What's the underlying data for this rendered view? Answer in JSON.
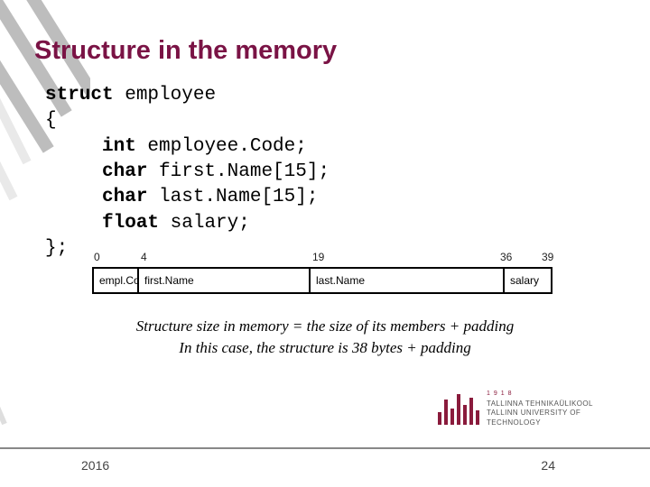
{
  "title": "Structure in the memory",
  "code": {
    "l1a": "struct",
    "l1b": " employee",
    "l2": "{",
    "l3a": "     int",
    "l3b": " employee.Code;",
    "l4a": "     char",
    "l4b": " first.Name[15];",
    "l5a": "     char",
    "l5b": " last.Name[15];",
    "l6a": "     float",
    "l6b": " salary;",
    "l7": "};"
  },
  "offsets": {
    "o0": "0",
    "o1": "4",
    "o2": "19",
    "o3": "36",
    "o4": "39"
  },
  "cells": {
    "c0": "empl.Co",
    "c1": "first.Name",
    "c2": "last.Name",
    "c3": "salary"
  },
  "explain": {
    "l1": "Structure size in memory = the size of its members + padding",
    "l2": "In this case, the structure is 38 bytes + padding"
  },
  "logo": {
    "year": "1918",
    "line1": "TALLINNA TEHNIKAÜLIKOOL",
    "line2": "TALLINN UNIVERSITY OF TECHNOLOGY"
  },
  "footer": {
    "year": "2016",
    "page": "24"
  }
}
